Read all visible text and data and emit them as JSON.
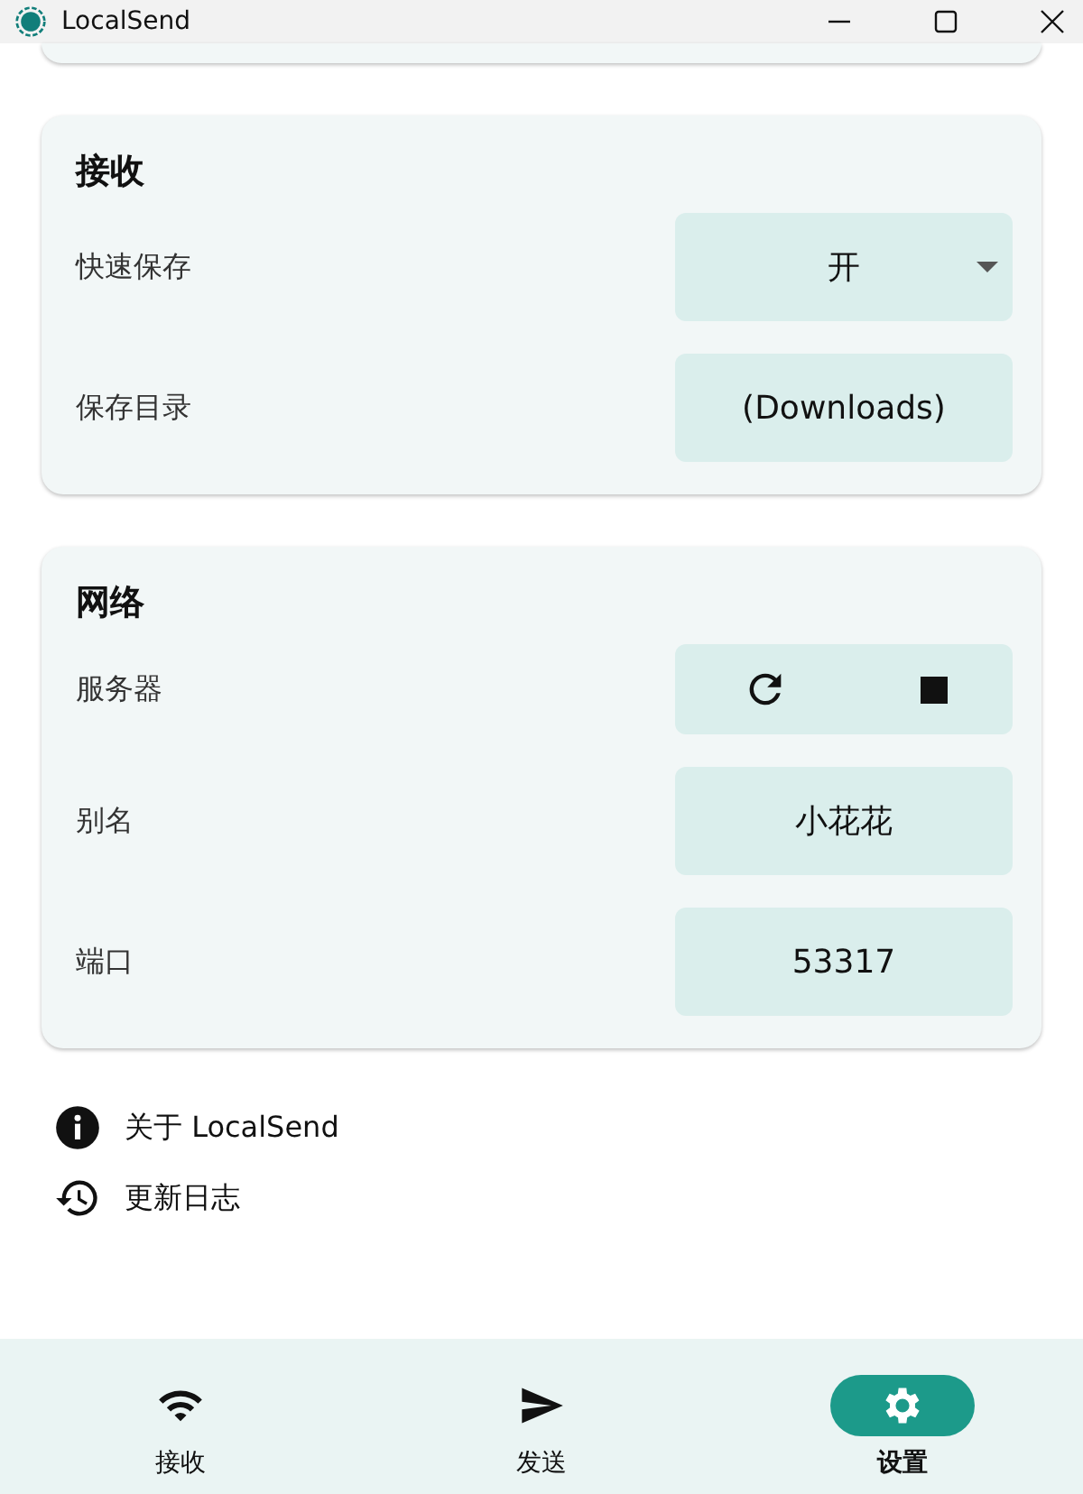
{
  "window": {
    "title": "LocalSend"
  },
  "sections": [
    {
      "title": "接收",
      "rows": [
        {
          "kind": "dropdown",
          "label": "快速保存",
          "value": "开"
        },
        {
          "kind": "value",
          "label": "保存目录",
          "value": "(Downloads)"
        }
      ]
    },
    {
      "title": "网络",
      "rows": [
        {
          "kind": "server",
          "label": "服务器"
        },
        {
          "kind": "value",
          "label": "别名",
          "value": "小花花"
        },
        {
          "kind": "value",
          "label": "端口",
          "value": "53317"
        }
      ]
    }
  ],
  "links": [
    {
      "kind": "info",
      "label": "关于 LocalSend"
    },
    {
      "kind": "history",
      "label": "更新日志"
    }
  ],
  "nav": [
    {
      "kind": "wifi",
      "label": "接收",
      "selected": false
    },
    {
      "kind": "send",
      "label": "发送",
      "selected": false
    },
    {
      "kind": "gear",
      "label": "设置",
      "selected": true
    }
  ]
}
